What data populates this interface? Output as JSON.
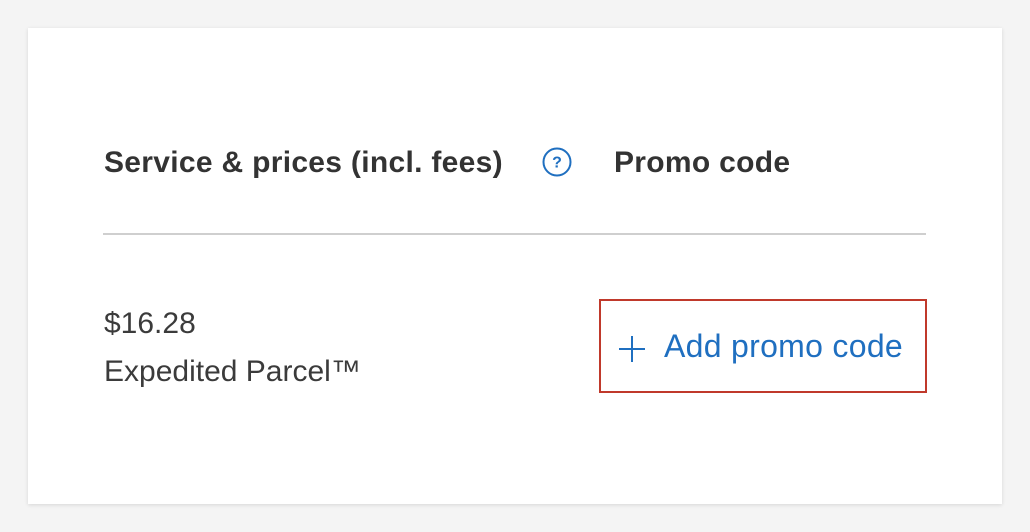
{
  "header": {
    "service_title": "Service & prices (incl. fees)",
    "promo_title": "Promo code",
    "help_icon": "question-circle-icon"
  },
  "service": {
    "price": "$16.28",
    "name": "Expedited Parcel™"
  },
  "promo": {
    "button_label": "Add promo code",
    "button_icon": "plus-icon"
  },
  "colors": {
    "accent": "#1f6fc0",
    "highlight_border": "#c0392b",
    "text": "#333333",
    "divider": "#cfcfcf"
  }
}
